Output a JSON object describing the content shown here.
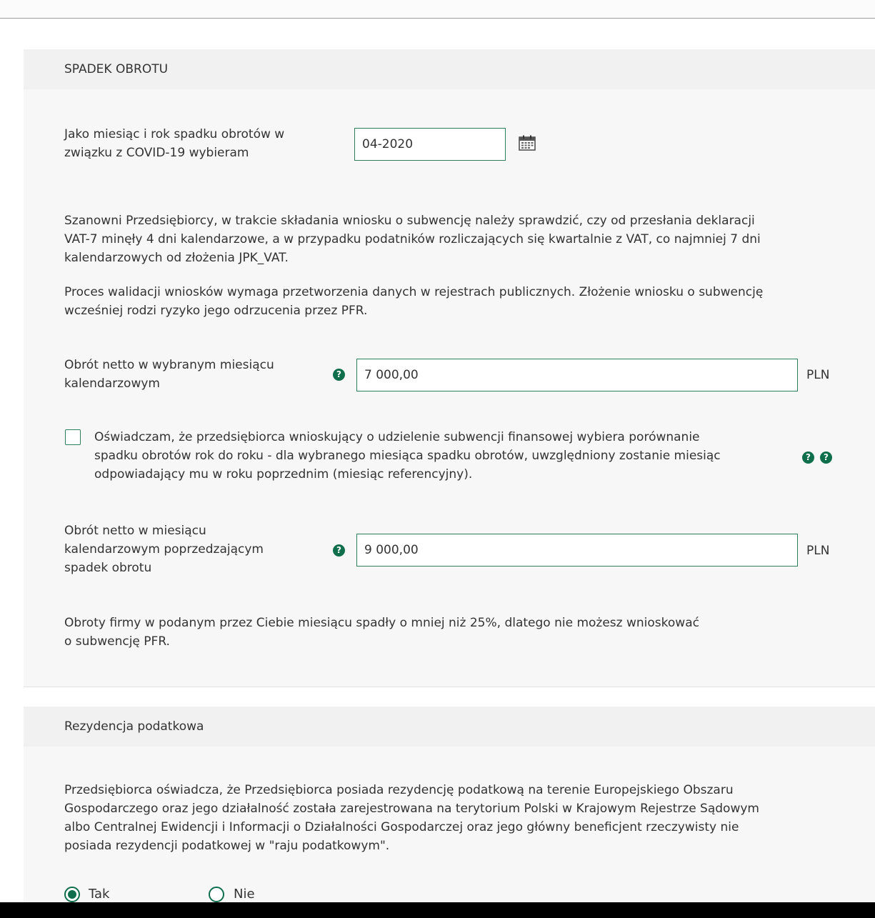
{
  "section1": {
    "title": "SPADEK OBROTU",
    "month_label_line1": "Jako miesiąc i rok spadku obrotów w",
    "month_label_line2": "związku z COVID-19 wybieram",
    "month_value": "04-2020",
    "info_para1_line1": "Szanowni Przedsiębiorcy, w trakcie składania wniosku o subwencję należy sprawdzić, czy od przesłania deklaracji",
    "info_para1_line2": "VAT-7 minęły 4 dni kalendarzowe, a w przypadku podatników rozliczających się kwartalnie z VAT, co najmniej 7 dni",
    "info_para1_line3": "kalendarzowych od złożenia JPK_VAT.",
    "info_para2_line1": "Proces walidacji wniosków wymaga przetworzenia danych w rejestrach publicznych. Złożenie wniosku o subwencję",
    "info_para2_line2": "wcześniej rodzi ryzyko jego odrzucenia przez PFR.",
    "turnover_label_line1": "Obrót netto w wybranym miesiącu",
    "turnover_label_line2": "kalendarzowym",
    "turnover_value": "7 000,00",
    "currency": "PLN",
    "checkbox_line1": "Oświadczam, że przedsiębiorca wnioskujący o udzielenie subwencji finansowej wybiera porównanie",
    "checkbox_line2": "spadku obrotów rok do roku - dla wybranego miesiąca spadku obrotów, uwzględniony zostanie miesiąc",
    "checkbox_line3": "odpowiadający mu w roku poprzednim (miesiąc referencyjny).",
    "checkbox_checked": false,
    "prev_label_line1": "Obrót netto w miesiącu",
    "prev_label_line2": "kalendarzowym poprzedzającym",
    "prev_label_line3": "spadek obrotu",
    "prev_value": "9 000,00",
    "result_line1": "Obroty firmy w podanym przez Ciebie miesiącu spadły o mniej niż 25%, dlatego nie możesz wnioskować",
    "result_line2": "o subwencję PFR.",
    "help_glyph": "?"
  },
  "section2": {
    "title": "Rezydencja podatkowa",
    "para_line1": "Przedsiębiorca oświadcza, że Przedsiębiorca posiada rezydencję podatkową na terenie Europejskiego Obszaru",
    "para_line2": "Gospodarczego oraz jego działalność została zarejestrowana na terytorium Polski w Krajowym Rejestrze Sądowym",
    "para_line3": "albo Centralnej Ewidencji i Informacji o Działalności Gospodarczej oraz jego główny beneficjent rzeczywisty nie",
    "para_line4": "posiada rezydencji podatkowej w \"raju podatkowym\".",
    "option_yes": "Tak",
    "option_no": "Nie",
    "selected": "Tak"
  },
  "colors": {
    "accent": "#0f6e4c",
    "border": "#2e7d5b",
    "panel": "#f7f7f7",
    "header": "#f1f1f1"
  },
  "icons": {
    "calendar": "calendar-icon",
    "help": "help-icon"
  }
}
